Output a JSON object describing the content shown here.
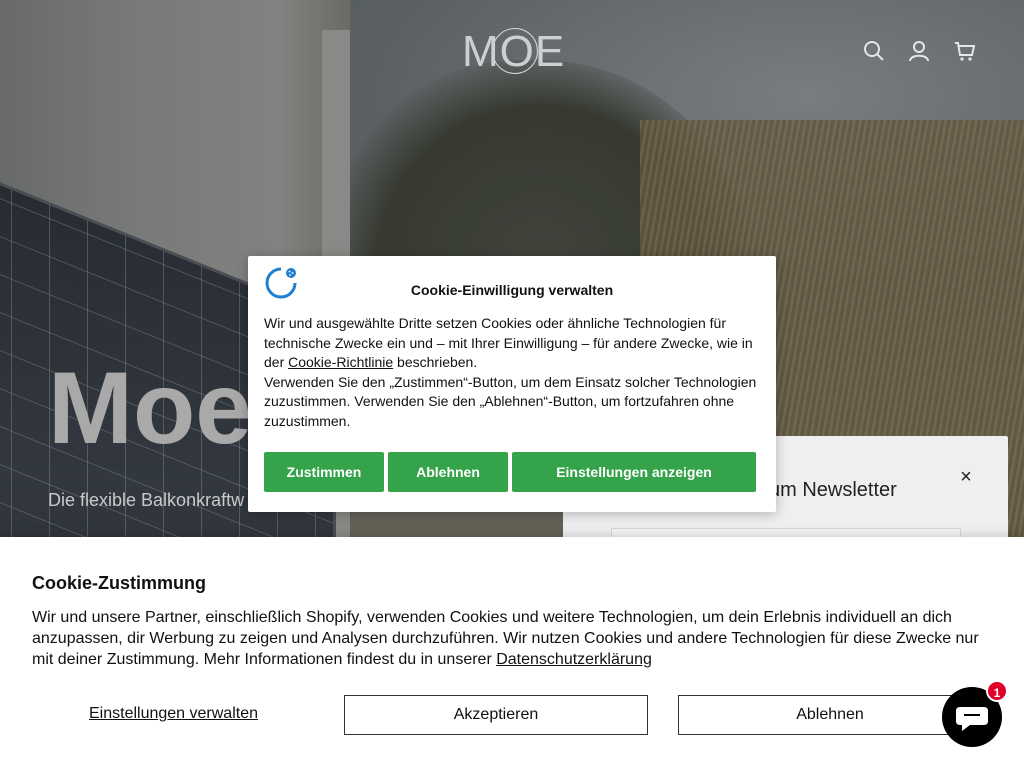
{
  "header": {
    "logo_text": "MOE",
    "icons": [
      "search-icon",
      "account-icon",
      "cart-icon"
    ]
  },
  "hero": {
    "title": "Moe",
    "subtitle": "Die flexible Balkonkraftw"
  },
  "newsletter": {
    "title": "zum Newsletter",
    "close_label": "×"
  },
  "consent_modal": {
    "title": "Cookie-Einwilligung verwalten",
    "body_part1": "Wir und ausgewählte Dritte setzen Cookies oder ähnliche Technologien für technische Zwecke ein und – mit Ihrer Einwilligung – für andere Zwecke, wie in der ",
    "policy_link": "Cookie-Richtlinie",
    "body_part2": " beschrieben.",
    "body_part3": "Verwenden Sie den „Zustimmen“-Button, um dem Einsatz solcher Technologien zuzustimmen. Verwenden Sie den „Ablehnen“-Button, um fortzufahren ohne zuzustimmen.",
    "buttons": {
      "accept": "Zustimmen",
      "reject": "Ablehnen",
      "settings": "Einstellungen anzeigen"
    },
    "accent_color": "#34a34a"
  },
  "cookie_banner": {
    "title": "Cookie-Zustimmung",
    "body": "Wir und unsere Partner, einschließlich Shopify, verwenden Cookies und weitere Technologien, um dein Erlebnis individuell an dich anzupassen, dir Werbung zu zeigen und Analysen durchzuführen. Wir nutzen Cookies und andere Technologien für diese Zwecke nur mit deiner Zustimmung. Mehr Informationen findest du in unserer ",
    "privacy_link": "Datenschutzerklärung",
    "manage_label": "Einstellungen verwalten",
    "accept_label": "Akzeptieren",
    "decline_label": "Ablehnen"
  },
  "chat": {
    "icon": "chat-icon",
    "badge_count": "1",
    "badge_color": "#e0002a"
  }
}
